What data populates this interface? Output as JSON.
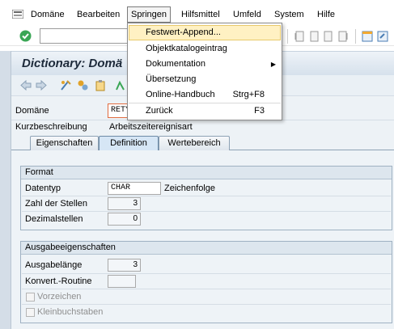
{
  "menubar": {
    "items": [
      "Domäne",
      "Bearbeiten",
      "Springen",
      "Hilfsmittel",
      "Umfeld",
      "System",
      "Hilfe"
    ],
    "active": "Springen"
  },
  "dropdown": {
    "items": [
      {
        "label": "Festwert-Append...",
        "shortcut": ""
      },
      {
        "label": "Objektkatalogeintrag",
        "shortcut": ""
      },
      {
        "label": "Dokumentation",
        "shortcut": "▶"
      },
      {
        "label": "Übersetzung",
        "shortcut": ""
      },
      {
        "label": "Online-Handbuch",
        "shortcut": "Strg+F8"
      },
      {
        "label": "Zurück",
        "shortcut": "F3"
      }
    ]
  },
  "title": "Dictionary: Domä",
  "header_fields": {
    "domain_label": "Domäne",
    "domain_value": "RETY",
    "short_desc_label": "Kurzbeschreibung",
    "short_desc_value": "Arbeitszeitereignisart"
  },
  "tabs": [
    "Eigenschaften",
    "Definition",
    "Wertebereich"
  ],
  "active_tab": "Definition",
  "format_group": {
    "title": "Format",
    "datatype_label": "Datentyp",
    "datatype_value": "CHAR",
    "datatype_desc": "Zeichenfolge",
    "digits_label": "Zahl der Stellen",
    "digits_value": "3",
    "decimals_label": "Dezimalstellen",
    "decimals_value": "0"
  },
  "output_group": {
    "title": "Ausgabeeigenschaften",
    "length_label": "Ausgabelänge",
    "length_value": "3",
    "conv_label": "Konvert.-Routine",
    "conv_value": "",
    "sign_label": "Vorzeichen",
    "lower_label": "Kleinbuchstaben"
  },
  "colors": {
    "accent": "#1d2a3a",
    "highlight": "#fff1c3",
    "green_check": "#3aa655",
    "active_tab": "#d6e6f5"
  }
}
